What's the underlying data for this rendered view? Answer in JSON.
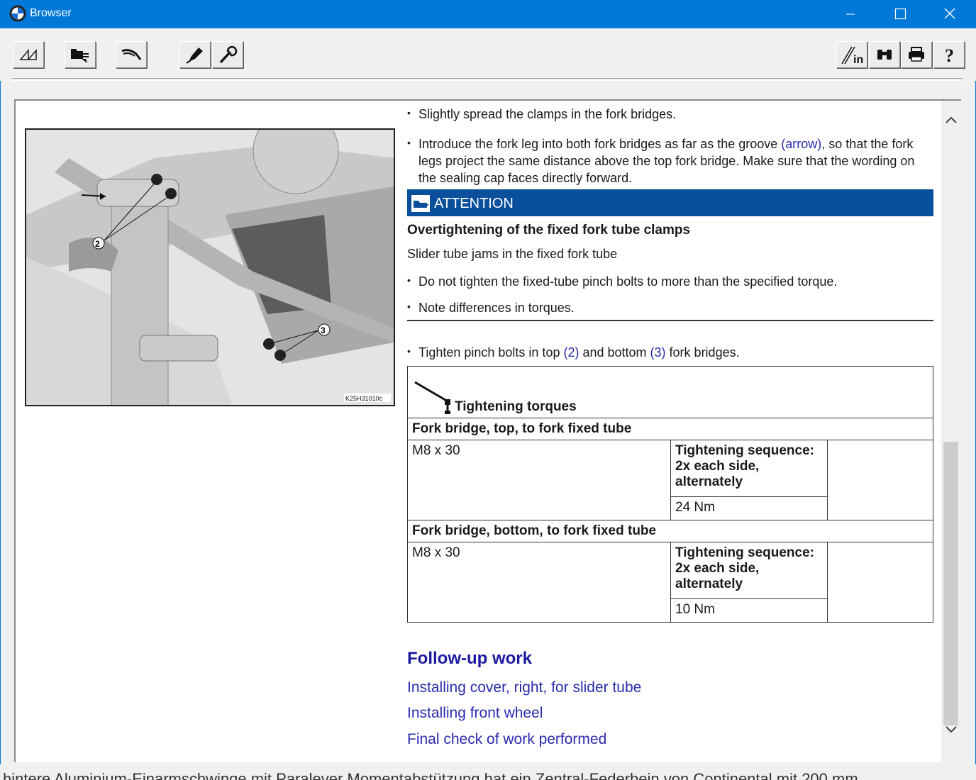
{
  "window": {
    "title": "Browser"
  },
  "toolbar": {
    "left_buttons": [
      "return-icon",
      "search-document-icon",
      "fork-icon",
      "marker-pen-icon",
      "wrench-icon"
    ],
    "right_buttons": [
      "info-icon",
      "binoculars-icon",
      "printer-icon",
      "help-icon"
    ],
    "info_label": "in",
    "help_label": "?"
  },
  "figure": {
    "caption_code": "K25H31010c",
    "callouts": [
      "2",
      "3"
    ]
  },
  "steps": {
    "step1": "Slightly spread the clamps in the fork bridges.",
    "step2_a": "Introduce the fork leg into both fork bridges as far as the groove ",
    "step2_link": "(arrow)",
    "step2_b": ", so that the fork legs project the same distance above the top fork bridge. Make sure that the wording on the sealing cap faces directly forward.",
    "attention_label": "ATTENTION",
    "attention_title": "Overtightening of the fixed fork tube clamps",
    "attention_text": "Slider tube jams in the fixed fork tube",
    "attention_bullet1": "Do not tighten the fixed-tube pinch bolts to more than the specified torque.",
    "attention_bullet2": "Note differences in torques.",
    "step3_a": "Tighten pinch bolts in top ",
    "step3_link1": "(2)",
    "step3_b": " and bottom ",
    "step3_link2": "(3)",
    "step3_c": " fork bridges."
  },
  "torque_table": {
    "heading": "Tightening torques",
    "sections": [
      {
        "title": "Fork bridge, top, to fork fixed tube",
        "bolt": "M8 x 30",
        "sequence": "Tightening sequence: 2x each side, alternately",
        "torque": "24 Nm"
      },
      {
        "title": "Fork bridge, bottom, to fork fixed tube",
        "bolt": "M8 x 30",
        "sequence": "Tightening sequence: 2x each side, alternately",
        "torque": "10 Nm"
      }
    ]
  },
  "followup": {
    "title": "Follow-up work",
    "links": [
      "Installing cover, right, for slider tube",
      "Installing front wheel",
      "Final check of work performed"
    ]
  },
  "bottom_ghost": "hintere Aluminium-Einarmschwinge mit Paralever Momentabstützung hat ein Zentral-Federbein von Continental mit 200 mm"
}
